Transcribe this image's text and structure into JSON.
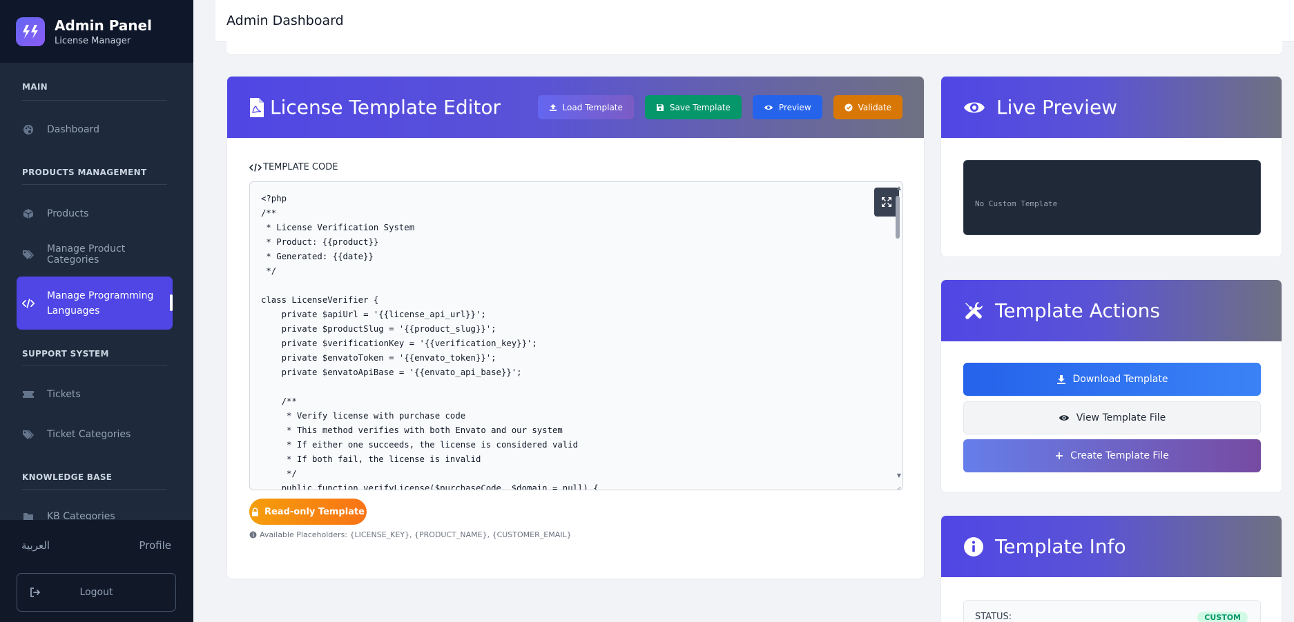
{
  "brand": {
    "title": "Admin Panel",
    "subtitle": "License Manager"
  },
  "sidebar": {
    "sections": [
      {
        "label": "MAIN"
      },
      {
        "label": "PRODUCTS MANAGEMENT"
      },
      {
        "label": "SUPPORT SYSTEM"
      },
      {
        "label": "KNOWLEDGE BASE"
      }
    ],
    "items": [
      {
        "label": "Dashboard",
        "icon": "palette-icon"
      },
      {
        "label": "Products",
        "icon": "box-icon"
      },
      {
        "label": "Manage Product Categories",
        "icon": "tags-icon"
      },
      {
        "label": "Manage Programming\nLanguages",
        "icon": "code-icon",
        "active": true
      },
      {
        "label": "Tickets",
        "icon": "ticket-icon"
      },
      {
        "label": "Ticket Categories",
        "icon": "tags-icon"
      },
      {
        "label": "KB Categories",
        "icon": "folder-icon"
      }
    ],
    "footer": {
      "language": "العربية",
      "profile": "Profile",
      "logout": "Logout"
    }
  },
  "topbar": {
    "title": "Admin Dashboard"
  },
  "editor": {
    "title": "License Template Editor",
    "buttons": {
      "load": "Load Template",
      "save": "Save Template",
      "preview": "Preview",
      "validate": "Validate"
    },
    "code_label": "TEMPLATE CODE",
    "code": "<?php\n/**\n * License Verification System\n * Product: {{product}}\n * Generated: {{date}}\n */\n\nclass LicenseVerifier {\n    private $apiUrl = '{{license_api_url}}';\n    private $productSlug = '{{product_slug}}';\n    private $verificationKey = '{{verification_key}}';\n    private $envatoToken = '{{envato_token}}';\n    private $envatoApiBase = '{{envato_api_base}}';\n\n    /**\n     * Verify license with purchase code\n     * This method verifies with both Envato and our system\n     * If either one succeeds, the license is considered valid\n     * If both fail, the license is invalid\n     */\n    public function verifyLicense($purchaseCode, $domain = null) {",
    "readonly_label": "Read-only Template",
    "placeholders_text": "Available Placeholders: {LICENSE_KEY}, {PRODUCT_NAME}, {CUSTOMER_EMAIL}"
  },
  "preview": {
    "title": "Live Preview",
    "content": "No Custom Template"
  },
  "actions": {
    "title": "Template Actions",
    "download": "Download Template",
    "view_file": "View Template File",
    "create": "Create Template File"
  },
  "info": {
    "title": "Template Info",
    "status_label": "STATUS:",
    "status_value": "CUSTOM"
  },
  "colors": {
    "sidebar_bg": "#1e293b",
    "accent": "#4f46e5",
    "save_green": "#059669",
    "preview_blue": "#2563eb",
    "validate_orange": "#d97706",
    "readonly_orange": "#f59e0b"
  }
}
